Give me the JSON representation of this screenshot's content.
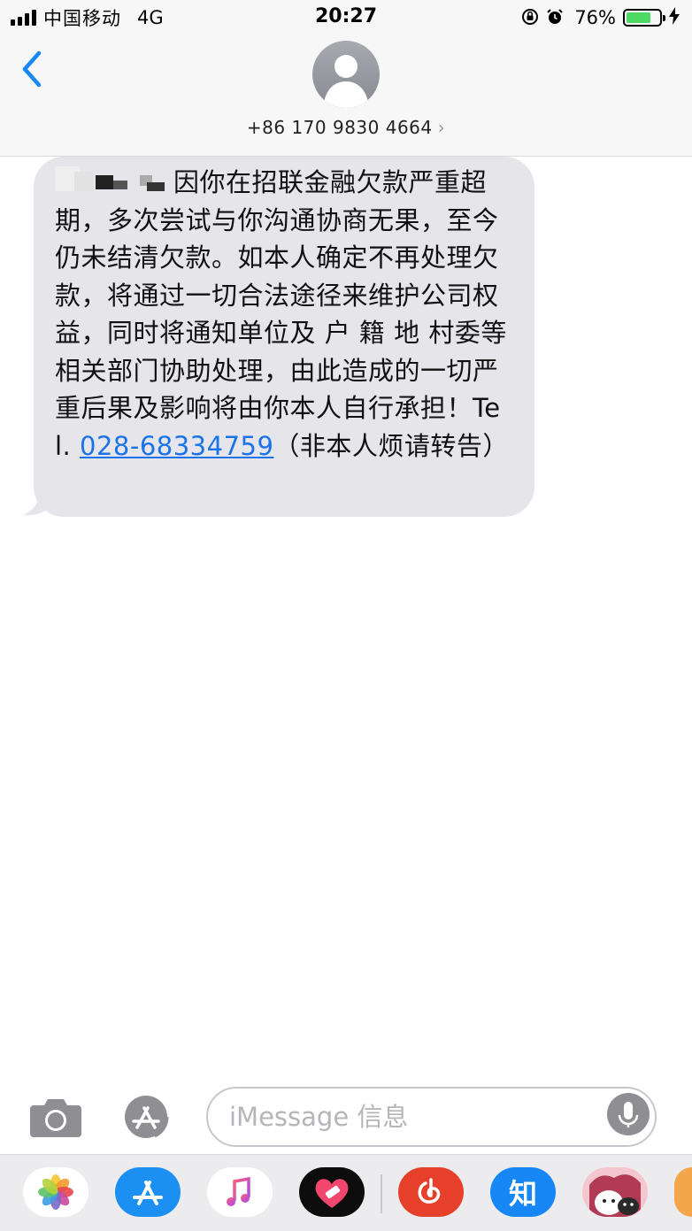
{
  "status_bar": {
    "carrier": "中国移动",
    "network": "4G",
    "time": "20:27",
    "orientation_lock_icon": "orientation-lock-icon",
    "alarm_icon": "alarm-icon",
    "battery_percent_label": "76%",
    "battery_level": 0.76,
    "charging_icon": "bolt-icon",
    "signal_bars": 4
  },
  "header": {
    "back_icon": "chevron-left-icon",
    "contact_name": "+86 170 9830 4664",
    "contact_chevron": "›"
  },
  "message": {
    "text_after_name": "因你在招联金融欠款严重超期，多次尝试与你沟通协商无果，至今仍未结清欠款。如本人确定不再处理欠款，将通过一切合法途径来维护公司权益，同时将通知单位及 户 籍 地 村委等相关部门协助处理，由此造成的一切严重后果及影响将由你本人自行承担！Tel. ",
    "phone_link": "028-68334759",
    "suffix": "（非本人烦请转告）"
  },
  "input_bar": {
    "camera_icon": "camera-icon",
    "appstore_icon": "app-store-icon",
    "placeholder": "iMessage 信息",
    "mic_icon": "microphone-icon"
  },
  "app_drawer": {
    "apps": [
      "photos-icon",
      "app-store-icon",
      "music-icon",
      "heart-sticker-icon",
      "netease-music-icon",
      "zhihu-icon",
      "sticker-pack-icon"
    ],
    "zhihu_label": "知"
  },
  "colors": {
    "bubble": "#e5e5ea",
    "link": "#1a73e8",
    "ios_blue": "#1687f5",
    "battery": "#4cd964"
  }
}
